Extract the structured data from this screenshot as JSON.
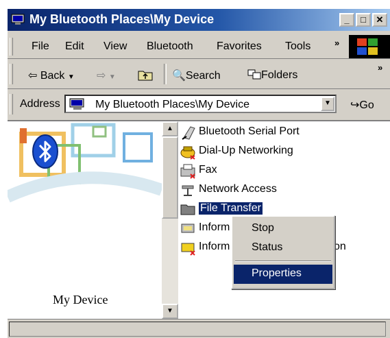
{
  "window": {
    "title": "My Bluetooth Places\\My Device",
    "controls": [
      "minimize",
      "maximize",
      "close"
    ]
  },
  "menubar": {
    "items": [
      "File",
      "Edit",
      "View",
      "Bluetooth",
      "Favorites",
      "Tools"
    ],
    "overflow": "»"
  },
  "toolbar": {
    "back": "Back",
    "search": "Search",
    "folders": "Folders",
    "overflow": "»"
  },
  "address": {
    "label": "Address",
    "value": "My Bluetooth Places\\My Device",
    "go": "Go"
  },
  "left_pane": {
    "device_label": "My Device"
  },
  "files": [
    {
      "label": "Bluetooth Serial Port",
      "icon": "serial-port-icon"
    },
    {
      "label": "Dial-Up Networking",
      "icon": "dialup-icon"
    },
    {
      "label": "Fax",
      "icon": "fax-icon"
    },
    {
      "label": "Network Access",
      "icon": "network-access-icon"
    },
    {
      "label": "File Transfer",
      "icon": "folder-icon",
      "selected": true
    },
    {
      "label": "Inform",
      "icon": "pim-icon"
    },
    {
      "label": "Inform",
      "icon": "pim-sync-icon",
      "suffix": "on"
    }
  ],
  "context_menu": {
    "items": [
      "Stop",
      "Status",
      "Properties"
    ],
    "highlighted": "Properties"
  },
  "colors": {
    "title_active": "#0a246a",
    "selection": "#0a246a",
    "chrome": "#d4d0c8"
  }
}
